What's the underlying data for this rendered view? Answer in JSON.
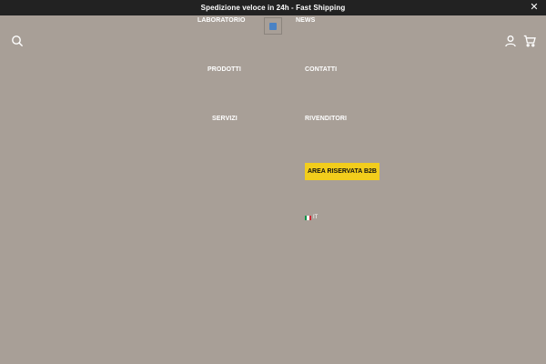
{
  "announcement": {
    "text": "Spedizione veloce in 24h - Fast Shipping",
    "close_glyph": "✕"
  },
  "header": {
    "search_icon": "search-icon",
    "account_icon": "user-icon",
    "cart_icon": "cart-icon"
  },
  "menu": {
    "laboratorio": "LABORATORIO",
    "news": "NEWS",
    "prodotti": "PRODOTTI",
    "contatti": "CONTATTI",
    "servizi": "SERVIZI",
    "rivenditori": "RIVENDITORI",
    "b2b": "AREA RISERVATA B2B"
  },
  "language": {
    "label": "IT",
    "flag_icon": "italy-flag-icon",
    "flag_colors": [
      "#009246",
      "#ffffff",
      "#ce2b37"
    ]
  },
  "colors": {
    "background": "#a89f97",
    "topbar": "#222222",
    "b2b_button": "#f2cd1c",
    "logo_mark": "#4a82c4"
  }
}
